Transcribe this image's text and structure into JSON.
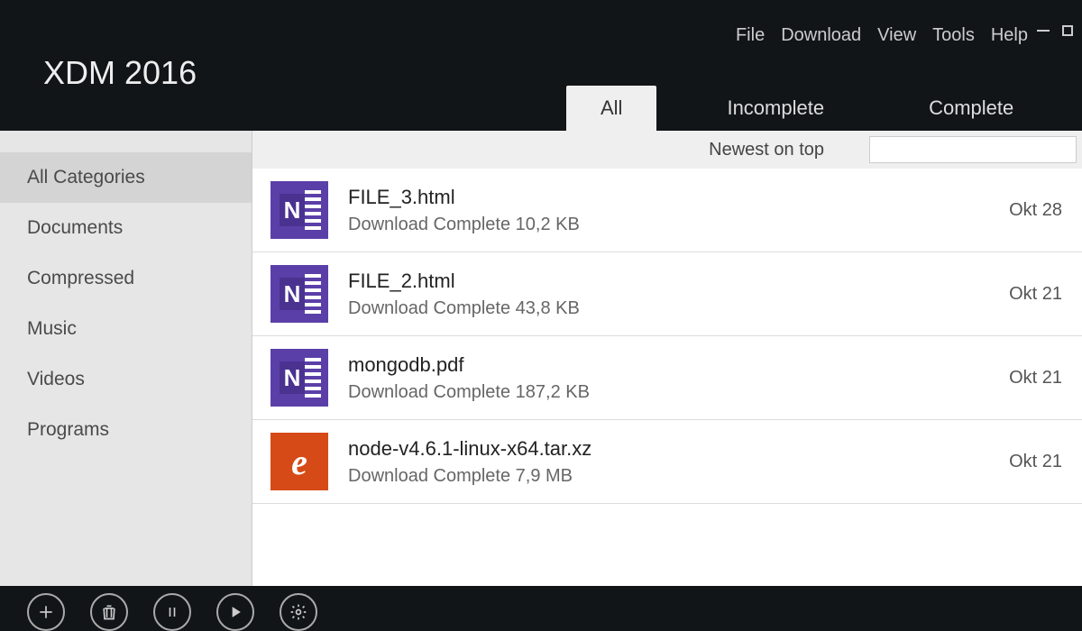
{
  "app": {
    "title": "XDM 2016"
  },
  "menu": {
    "file": "File",
    "download": "Download",
    "view": "View",
    "tools": "Tools",
    "help": "Help"
  },
  "tabs": {
    "all": "All",
    "incomplete": "Incomplete",
    "complete": "Complete"
  },
  "sidebar": {
    "items": [
      {
        "label": "All Categories"
      },
      {
        "label": "Documents"
      },
      {
        "label": "Compressed"
      },
      {
        "label": "Music"
      },
      {
        "label": "Videos"
      },
      {
        "label": "Programs"
      }
    ]
  },
  "sort": {
    "label": "Newest on top"
  },
  "downloads": [
    {
      "name": "FILE_3.html",
      "status": "Download Complete 10,2 KB",
      "date": "Okt 28",
      "icon": "onenote"
    },
    {
      "name": "FILE_2.html",
      "status": "Download Complete 43,8 KB",
      "date": "Okt 21",
      "icon": "onenote"
    },
    {
      "name": "mongodb.pdf",
      "status": "Download Complete 187,2 KB",
      "date": "Okt 21",
      "icon": "onenote"
    },
    {
      "name": "node-v4.6.1-linux-x64.tar.xz",
      "status": "Download Complete 7,9 MB",
      "date": "Okt 21",
      "icon": "ie"
    }
  ]
}
